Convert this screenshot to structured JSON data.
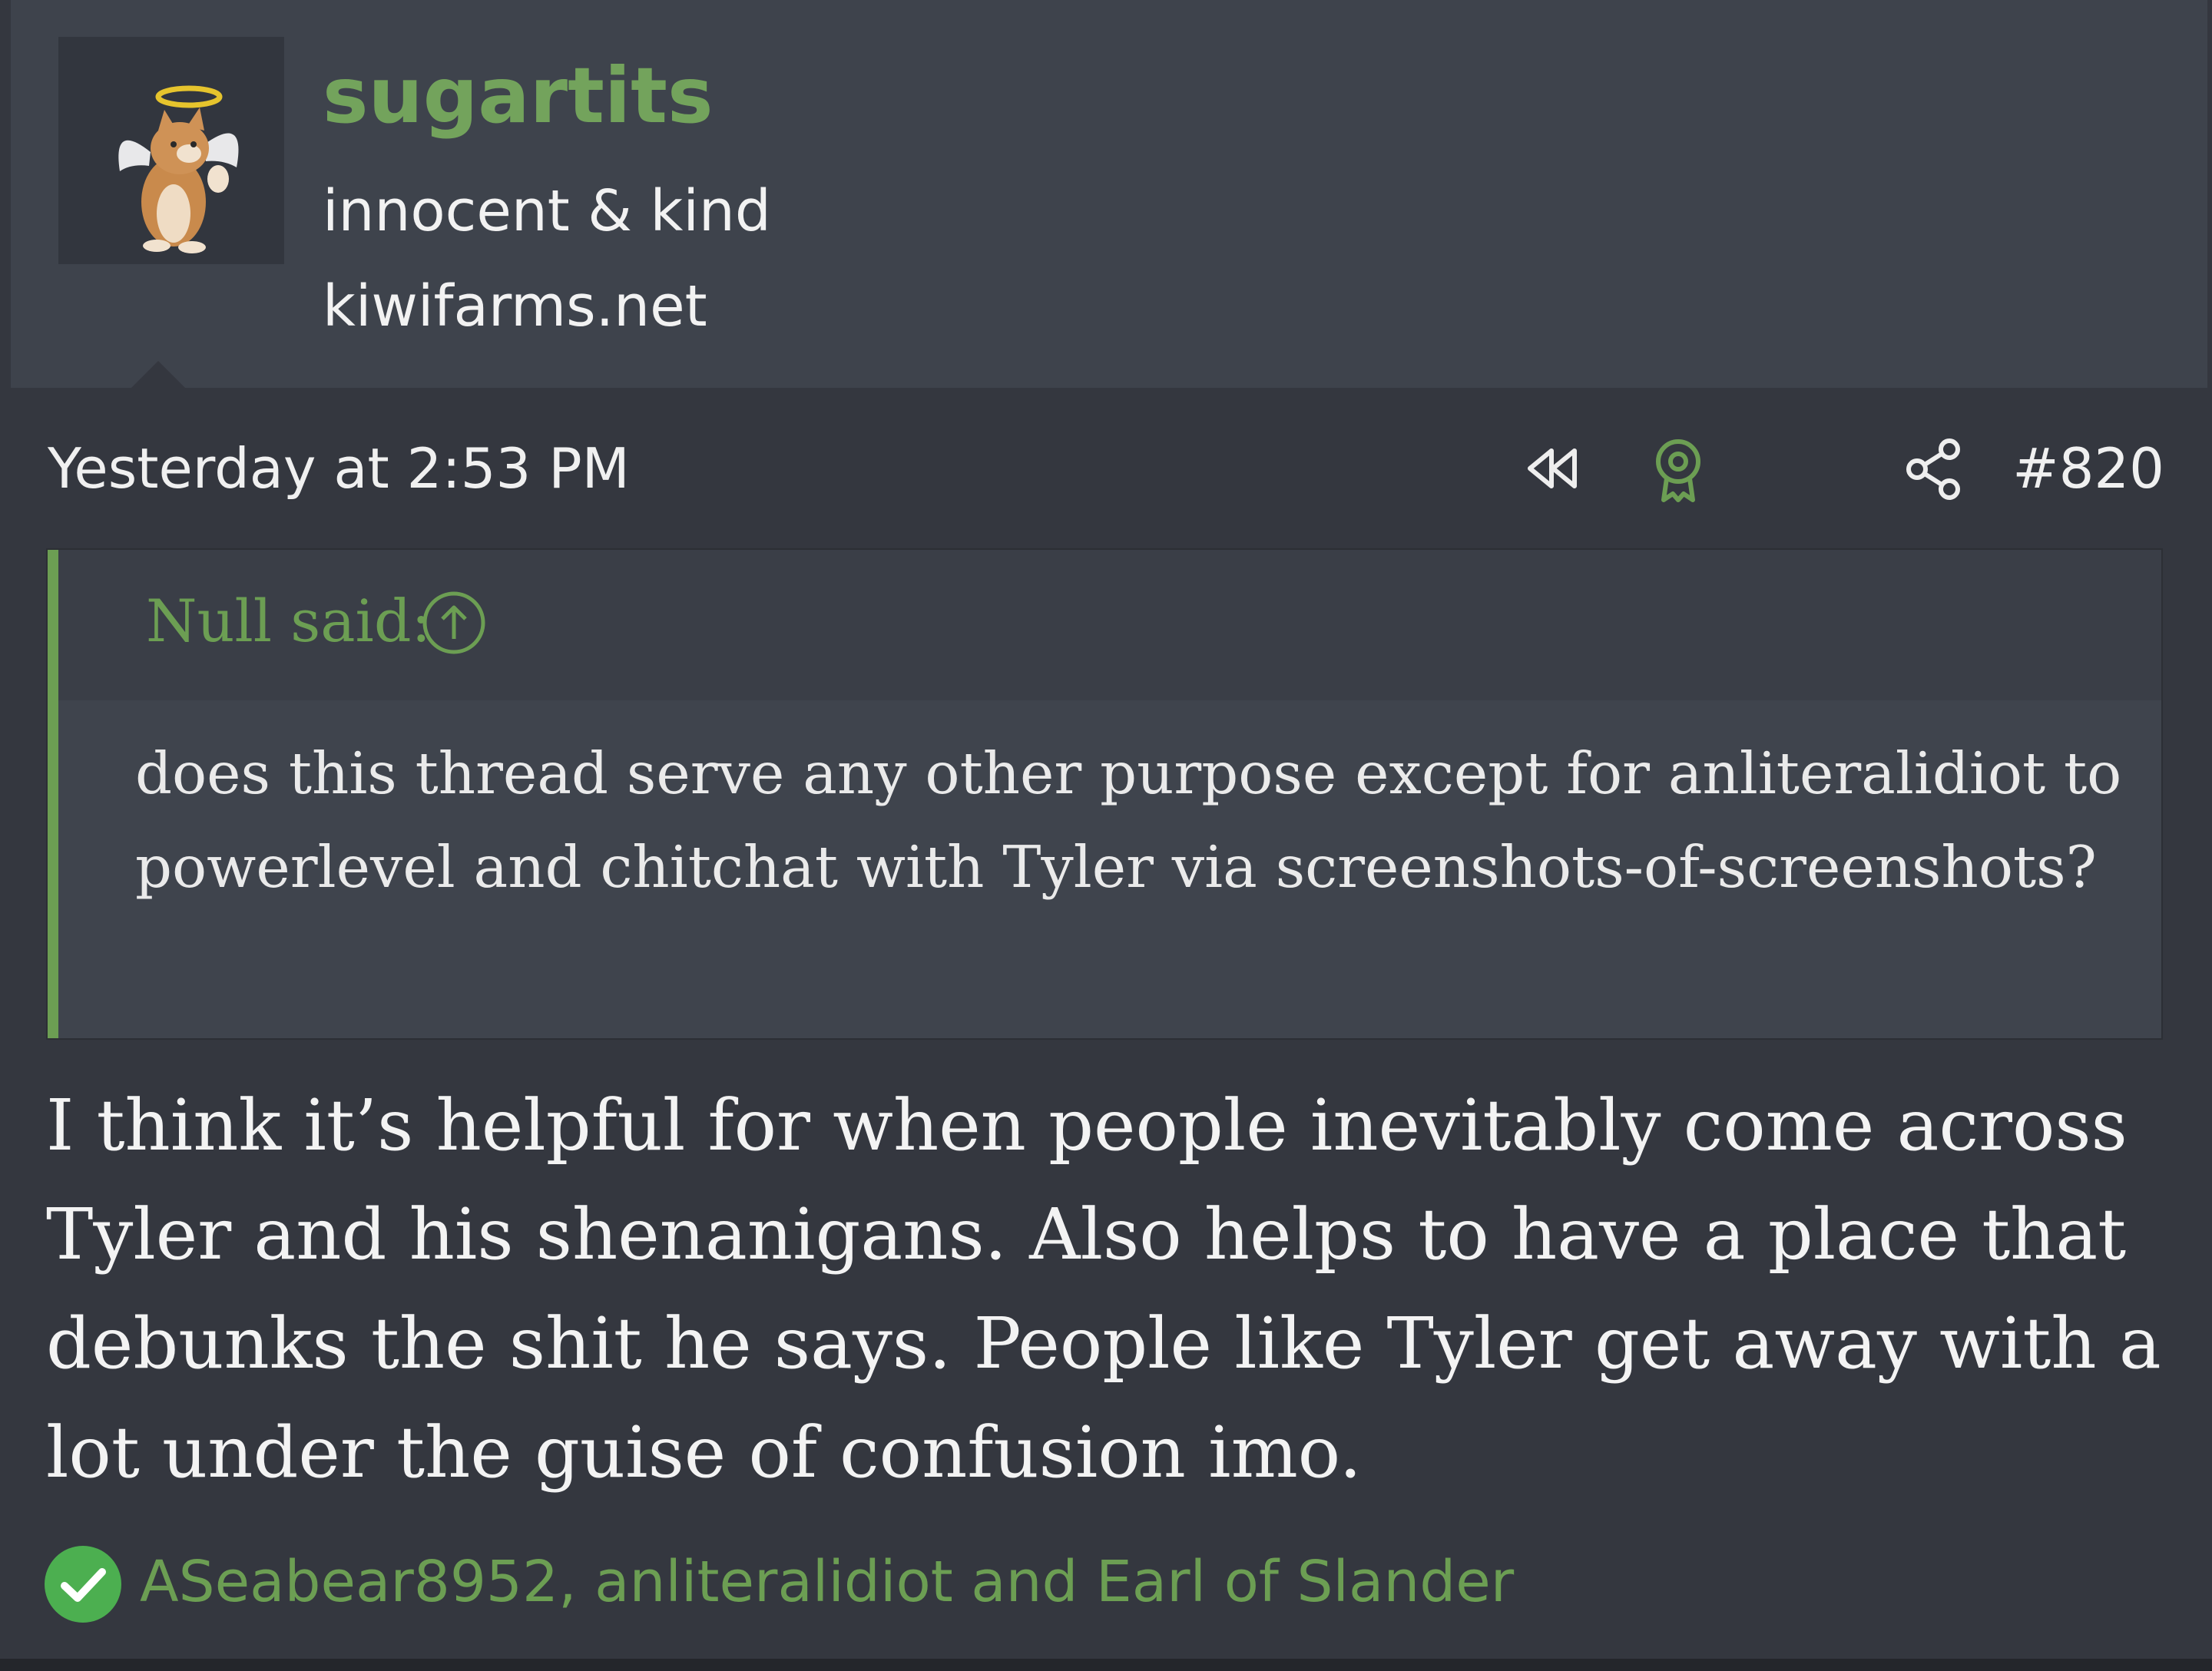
{
  "user": {
    "name": "sugartits",
    "title": "innocent & kind",
    "site": "kiwifarms.net"
  },
  "post": {
    "date": "Yesterday at 2:53 PM",
    "number": "#820",
    "icons": [
      "rewind-icon",
      "award-icon",
      "share-icon"
    ]
  },
  "quote": {
    "author": "Null said:",
    "text": "does this thread serve any other purpose except for anliteralidiot to powerlevel and chitchat with Tyler via screenshots-of-screenshots?"
  },
  "body": {
    "text": "I think it’s helpful for when people inevitably come across Tyler and his shenanigans. Also helps to have a place that debunks the shit he says. People like Tyler get away with a lot under the guise of confusion imo."
  },
  "reactions": {
    "users": "ASeabear8952, anliteralidiot and Earl of Slander"
  },
  "colors": {
    "accent": "#6c9e53",
    "username": "#73a35c",
    "background": "#34373f",
    "header": "#3e434c",
    "quote_bg": "#3f444d",
    "reaction_check": "#4caf50"
  }
}
